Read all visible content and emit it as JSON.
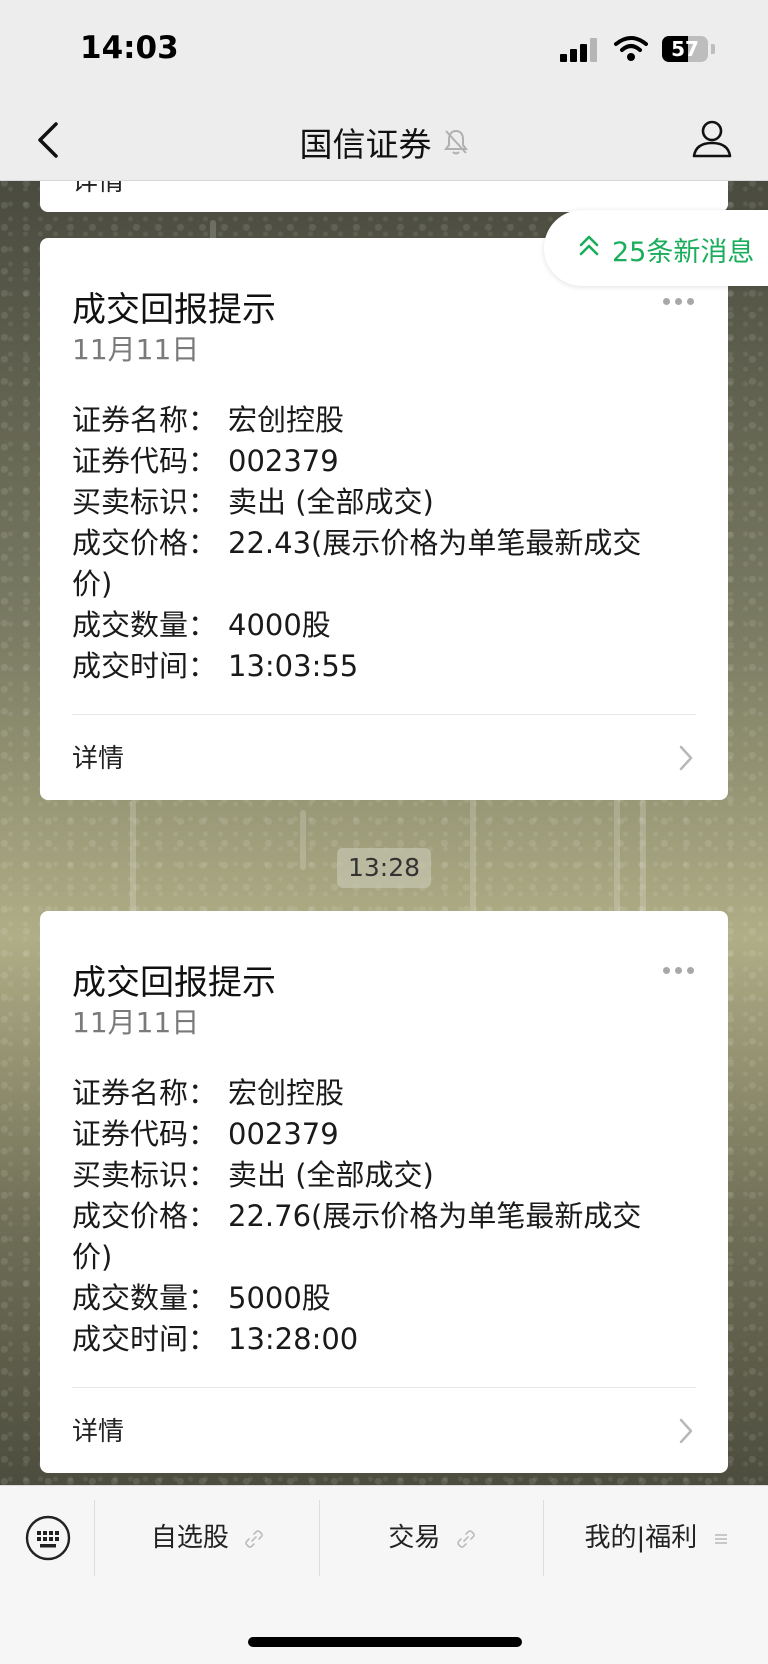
{
  "status_bar": {
    "time": "14:03",
    "battery_level": "57",
    "battery_fraction": 0.57
  },
  "nav": {
    "title": "国信证券"
  },
  "previous_card": {
    "detail_label": "详情"
  },
  "new_messages": {
    "label": "25条新消息"
  },
  "cards": [
    {
      "title": "成交回报提示",
      "date": "11月11日",
      "fields": [
        {
          "key": "证券名称：",
          "value": "宏创控股"
        },
        {
          "key": "证券代码：",
          "value": "002379"
        },
        {
          "key": "买卖标识：",
          "value": "卖出 (全部成交)"
        },
        {
          "key": "成交价格：",
          "value": "22.43(展示价格为单笔最新成交价)"
        },
        {
          "key": "成交数量：",
          "value": "4000股"
        },
        {
          "key": "成交时间：",
          "value": "13:03:55"
        }
      ],
      "detail_label": "详情"
    },
    {
      "title": "成交回报提示",
      "date": "11月11日",
      "fields": [
        {
          "key": "证券名称：",
          "value": "宏创控股"
        },
        {
          "key": "证券代码：",
          "value": "002379"
        },
        {
          "key": "买卖标识：",
          "value": "卖出 (全部成交)"
        },
        {
          "key": "成交价格：",
          "value": "22.76(展示价格为单笔最新成交价)"
        },
        {
          "key": "成交数量：",
          "value": "5000股"
        },
        {
          "key": "成交时间：",
          "value": "13:28:00"
        }
      ],
      "detail_label": "详情"
    }
  ],
  "timestamp_divider": "13:28",
  "bottom_menu": {
    "items": [
      {
        "label": "自选股",
        "icon": "link-icon"
      },
      {
        "label": "交易",
        "icon": "link-icon"
      },
      {
        "label": "我的|福利",
        "icon": "menu-icon"
      }
    ]
  },
  "colors": {
    "accent": "#1aad5b",
    "bar_bg": "#ededed",
    "card_bg": "#ffffff"
  }
}
